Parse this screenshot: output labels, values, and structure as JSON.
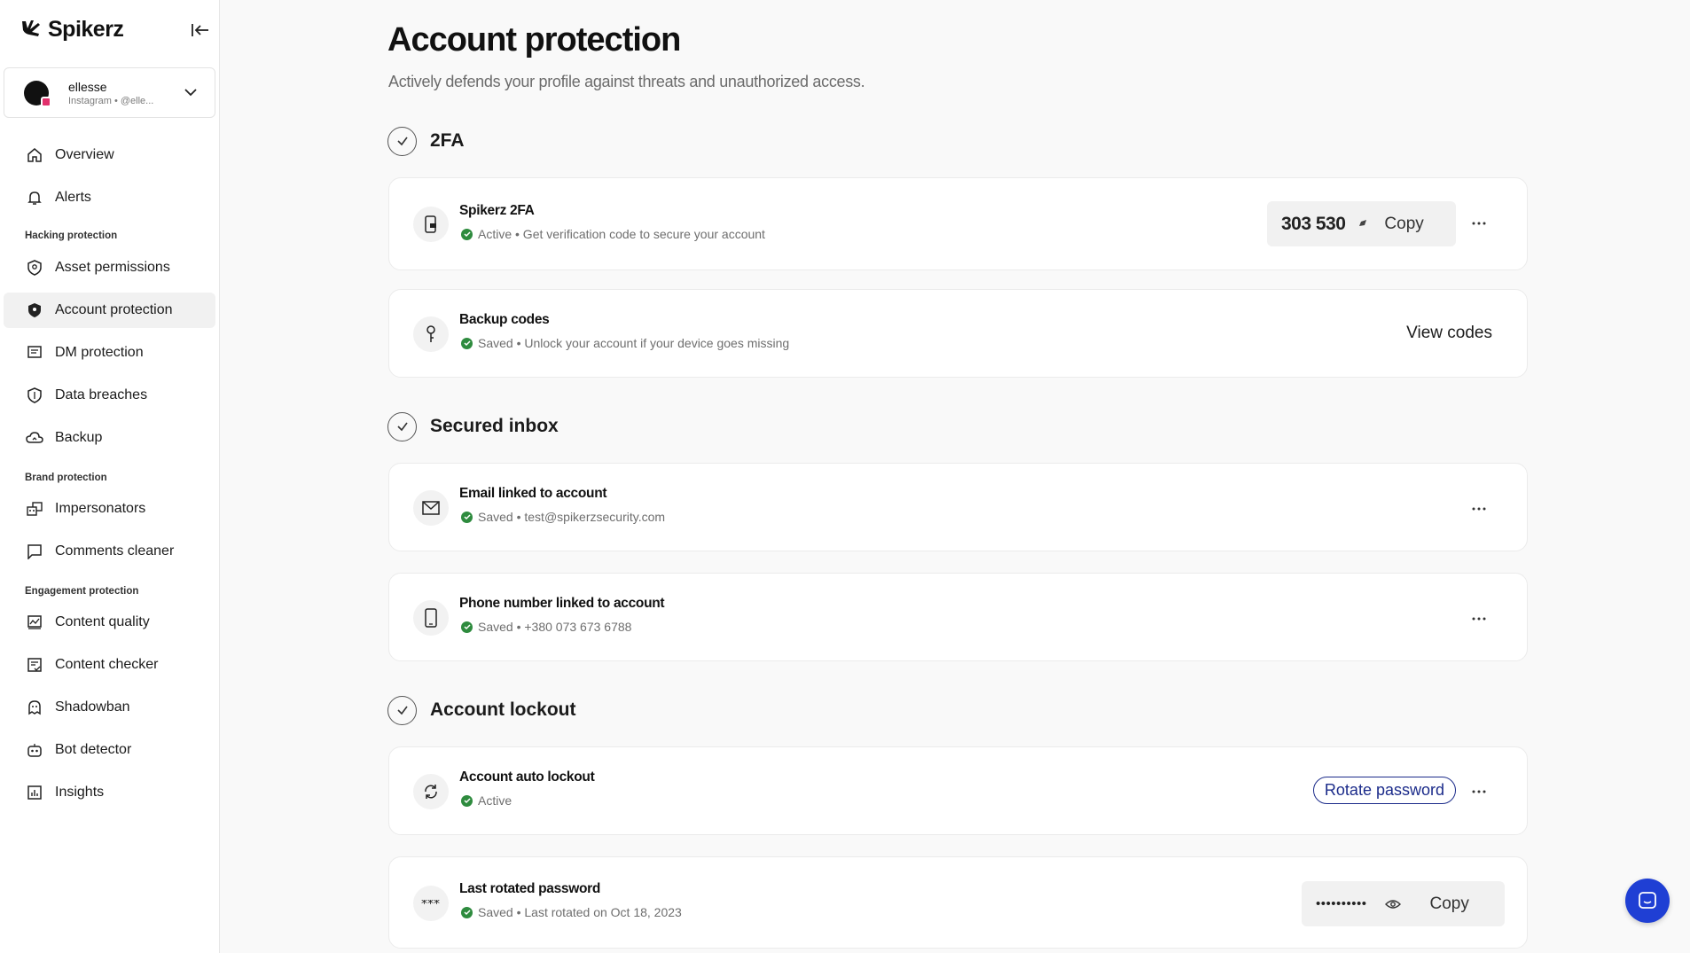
{
  "brand": {
    "name": "Spikerz"
  },
  "account": {
    "name": "ellesse",
    "sub": "Instagram • @elle..."
  },
  "nav": {
    "overview": "Overview",
    "alerts": "Alerts",
    "section_hacking": "Hacking protection",
    "asset_permissions": "Asset permissions",
    "account_protection": "Account protection",
    "dm_protection": "DM protection",
    "data_breaches": "Data breaches",
    "backup": "Backup",
    "section_brand": "Brand protection",
    "impersonators": "Impersonators",
    "comments_cleaner": "Comments cleaner",
    "section_engagement": "Engagement protection",
    "content_quality": "Content quality",
    "content_checker": "Content checker",
    "shadowban": "Shadowban",
    "bot_detector": "Bot detector",
    "insights": "Insights"
  },
  "page": {
    "title": "Account protection",
    "subtitle": "Actively defends your profile against threats and unauthorized access."
  },
  "sections": {
    "twofa": "2FA",
    "inbox": "Secured inbox",
    "lockout": "Account lockout"
  },
  "cards": {
    "spikerz2fa": {
      "title": "Spikerz 2FA",
      "status": "Active • Get verification code to secure your account",
      "code": "303 530",
      "copy": "Copy"
    },
    "backup": {
      "title": "Backup codes",
      "status": "Saved • Unlock your account if your device goes missing",
      "action": "View codes"
    },
    "email": {
      "title": "Email linked to account",
      "status": "Saved • test@spikerzsecurity.com"
    },
    "phone": {
      "title": "Phone number linked to account",
      "status": "Saved • +380 073 673 6788"
    },
    "autolockout": {
      "title": "Account auto lockout",
      "status": "Active",
      "action": "Rotate password"
    },
    "password": {
      "title": "Last rotated password",
      "status": "Saved • Last rotated on Oct 18, 2023",
      "masked": "••••••••••",
      "copy": "Copy"
    }
  },
  "colors": {
    "accent": "#1f3fd4",
    "status_ok": "#2e8b3e",
    "rotate_border": "#1b2b8a"
  },
  "icons": [
    "spikerz-logo-icon",
    "collapse-sidebar-icon",
    "chevron-down-icon",
    "home-icon",
    "bell-icon",
    "shield-user-icon",
    "shield-filled-icon",
    "message-lines-icon",
    "shield-outline-icon",
    "cloud-icon",
    "mask-icon",
    "comment-square-icon",
    "image-chart-icon",
    "document-check-icon",
    "ghost-icon",
    "robot-icon",
    "bar-chart-icon",
    "check-icon",
    "phone-lock-icon",
    "key-icon",
    "mail-icon",
    "mobile-icon",
    "rotate-icon",
    "asterisk-icon",
    "copy-icon",
    "eye-icon",
    "more-horizontal-icon",
    "chat-icon"
  ]
}
